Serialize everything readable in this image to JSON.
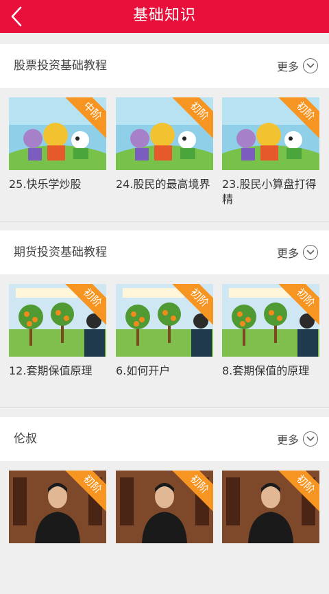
{
  "header": {
    "title": "基础知识"
  },
  "more_label": "更多",
  "sections": [
    {
      "title": "股票投资基础教程",
      "cards": [
        {
          "title": "25.快乐学炒股",
          "level": "中阶"
        },
        {
          "title": "24.股民的最高境界",
          "level": "初阶"
        },
        {
          "title": "23.股民小算盘打得精",
          "level": "初阶"
        }
      ]
    },
    {
      "title": "期货投资基础教程",
      "cards": [
        {
          "title": "12.套期保值原理",
          "level": "初阶"
        },
        {
          "title": "6.如何开户",
          "level": "初阶"
        },
        {
          "title": "8.套期保值的原理",
          "level": "初阶"
        }
      ]
    },
    {
      "title": "伦叔",
      "cards": [
        {
          "title": "",
          "level": "初阶"
        },
        {
          "title": "",
          "level": "初阶"
        },
        {
          "title": "",
          "level": "初阶"
        }
      ]
    }
  ],
  "colors": {
    "brand_red": "#e8103a",
    "ribbon_orange": "#f79523"
  },
  "icons": {
    "back": "chevron-left-icon",
    "more": "chevron-down-circle-icon"
  }
}
